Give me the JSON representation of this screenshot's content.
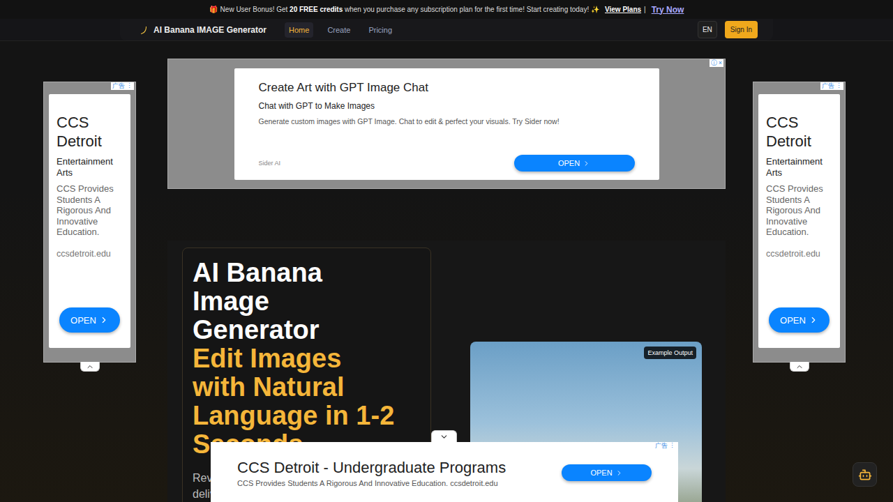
{
  "banner": {
    "icon": "🎁",
    "lead": "New User Bonus! Get ",
    "highlight": "20 FREE credits",
    "rest": " when you purchase any subscription plan for the first time! Start creating today! ✨",
    "link": "View Plans",
    "separator": "|",
    "cta": "Try Now"
  },
  "nav": {
    "brand": "AI Banana IMAGE Generator",
    "items": [
      {
        "label": "Home",
        "selected": true
      },
      {
        "label": "Create",
        "selected": false
      },
      {
        "label": "Pricing",
        "selected": false
      }
    ],
    "language": "EN",
    "sign_in": "Sign In"
  },
  "top_ad": {
    "info": "ⓘ",
    "close": "×",
    "title": "Create Art with GPT Image Chat",
    "subtitle": "Chat with GPT to Make Images",
    "body": "Generate custom images with GPT Image. Chat to edit & perfect your visuals. Try Sider now!",
    "advertiser": "Sider AI",
    "button": "OPEN"
  },
  "side_ads": [
    {
      "label": "广告",
      "menu": "⋮",
      "title": "CCS Detroit",
      "subtitle": "Entertainment Arts",
      "body": "CCS Provides Students A Rigorous And Innovative Education.",
      "url": "ccsdetroit.edu",
      "button": "OPEN"
    },
    {
      "label": "广告",
      "menu": "⋮",
      "title": "CCS Detroit",
      "subtitle": "Entertainment Arts",
      "body": "CCS Provides Students A Rigorous And Innovative Education.",
      "url": "ccsdetroit.edu",
      "button": "OPEN"
    }
  ],
  "hero": {
    "title_lines": [
      "AI Banana",
      "Image",
      "Generator"
    ],
    "accent_lines": [
      "Edit Images",
      "with Natural",
      "Language in 1-2",
      "Seconds"
    ],
    "description_lines": [
      "Revo",
      "deliv"
    ],
    "example_badge": "Example Output"
  },
  "bottom_ad": {
    "label": "广告",
    "menu": "⋮",
    "title": "CCS Detroit - Undergraduate Programs",
    "body": "CCS Provides Students A Rigorous And Innovative Education. ccsdetroit.edu",
    "button": "OPEN",
    "expanded": true
  }
}
